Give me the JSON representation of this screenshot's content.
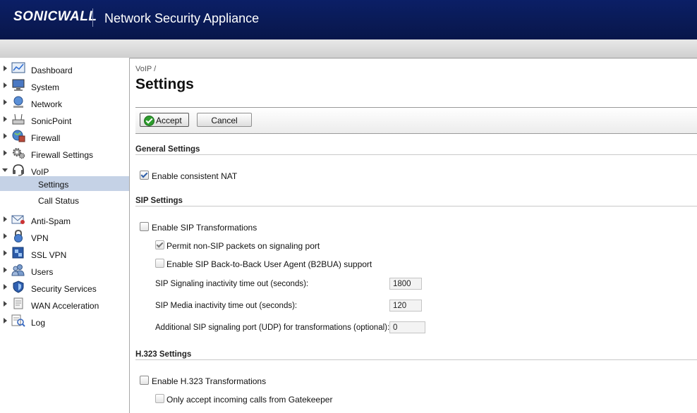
{
  "header": {
    "logo": "SONICWALL",
    "title": "Network Security Appliance"
  },
  "sidebar": {
    "items": [
      {
        "label": "Dashboard",
        "icon": "dashboard-icon"
      },
      {
        "label": "System",
        "icon": "monitor-icon"
      },
      {
        "label": "Network",
        "icon": "network-icon"
      },
      {
        "label": "SonicPoint",
        "icon": "access-point-icon"
      },
      {
        "label": "Firewall",
        "icon": "firewall-icon"
      },
      {
        "label": "Firewall Settings",
        "icon": "gear-icon"
      },
      {
        "label": "VoIP",
        "icon": "headset-icon"
      },
      {
        "label": "Anti-Spam",
        "icon": "mail-icon"
      },
      {
        "label": "VPN",
        "icon": "lock-icon"
      },
      {
        "label": "SSL VPN",
        "icon": "ssl-icon"
      },
      {
        "label": "Users",
        "icon": "users-icon"
      },
      {
        "label": "Security Services",
        "icon": "shield-icon"
      },
      {
        "label": "WAN Acceleration",
        "icon": "wan-icon"
      },
      {
        "label": "Log",
        "icon": "log-icon"
      }
    ],
    "voip_subitems": [
      {
        "label": "Settings",
        "active": true
      },
      {
        "label": "Call Status",
        "active": false
      }
    ]
  },
  "main": {
    "breadcrumb": "VoIP /",
    "title": "Settings",
    "toolbar": {
      "accept_label": "Accept",
      "cancel_label": "Cancel"
    },
    "general": {
      "title": "General Settings",
      "consistent_nat": {
        "label": "Enable consistent NAT",
        "checked": true
      }
    },
    "sip": {
      "title": "SIP Settings",
      "enable_transformations": {
        "label": "Enable SIP Transformations",
        "checked": false
      },
      "permit_non_sip": {
        "label": "Permit non-SIP packets on signaling port",
        "checked": true
      },
      "b2bua": {
        "label": "Enable SIP Back-to-Back User Agent (B2BUA) support",
        "checked": false
      },
      "signaling_timeout": {
        "label": "SIP Signaling inactivity time out (seconds):",
        "value": "1800"
      },
      "media_timeout": {
        "label": "SIP Media inactivity time out (seconds):",
        "value": "120"
      },
      "additional_port": {
        "label": "Additional SIP signaling port (UDP) for transformations (optional):",
        "value": "0"
      }
    },
    "h323": {
      "title": "H.323 Settings",
      "enable_transformations": {
        "label": "Enable H.323 Transformations",
        "checked": false
      },
      "gatekeeper_only": {
        "label": "Only accept incoming calls from Gatekeeper",
        "checked": false
      }
    }
  }
}
